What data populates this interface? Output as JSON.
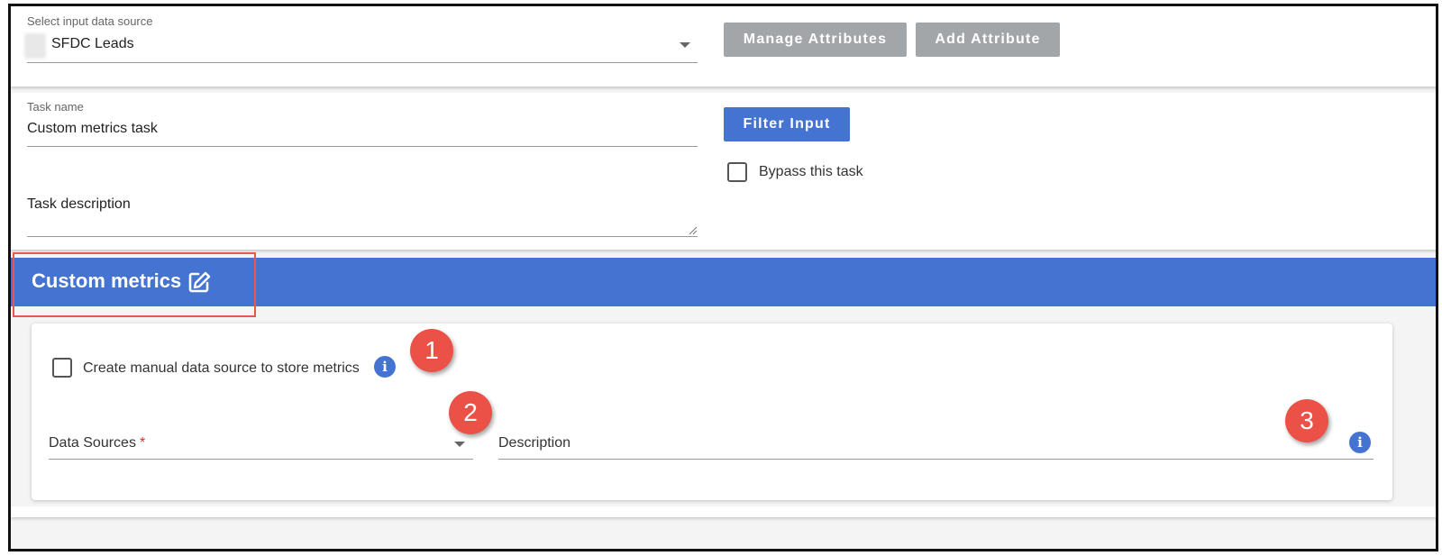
{
  "source_section": {
    "label": "Select input data source",
    "value": "SFDC Leads",
    "manage_button": "Manage Attributes",
    "add_button": "Add Attribute"
  },
  "task_section": {
    "name_label": "Task name",
    "name_value": "Custom metrics task",
    "filter_button": "Filter Input",
    "bypass_label": "Bypass this task",
    "description_placeholder": "Task description"
  },
  "metrics_section": {
    "title": "Custom metrics",
    "manual_source_label": "Create manual data source to store metrics",
    "data_sources_label": "Data Sources",
    "required_mark": "*",
    "description_label": "Description"
  },
  "callouts": [
    "1",
    "2",
    "3"
  ],
  "icons": {
    "edit": "edit-icon",
    "info": "info-icon",
    "dropdown": "chevron-down-icon"
  },
  "colors": {
    "primary": "#4573d2",
    "disabled_button": "#a3a6a8",
    "callout": "#ec5147",
    "highlight_border": "#e6594c"
  }
}
